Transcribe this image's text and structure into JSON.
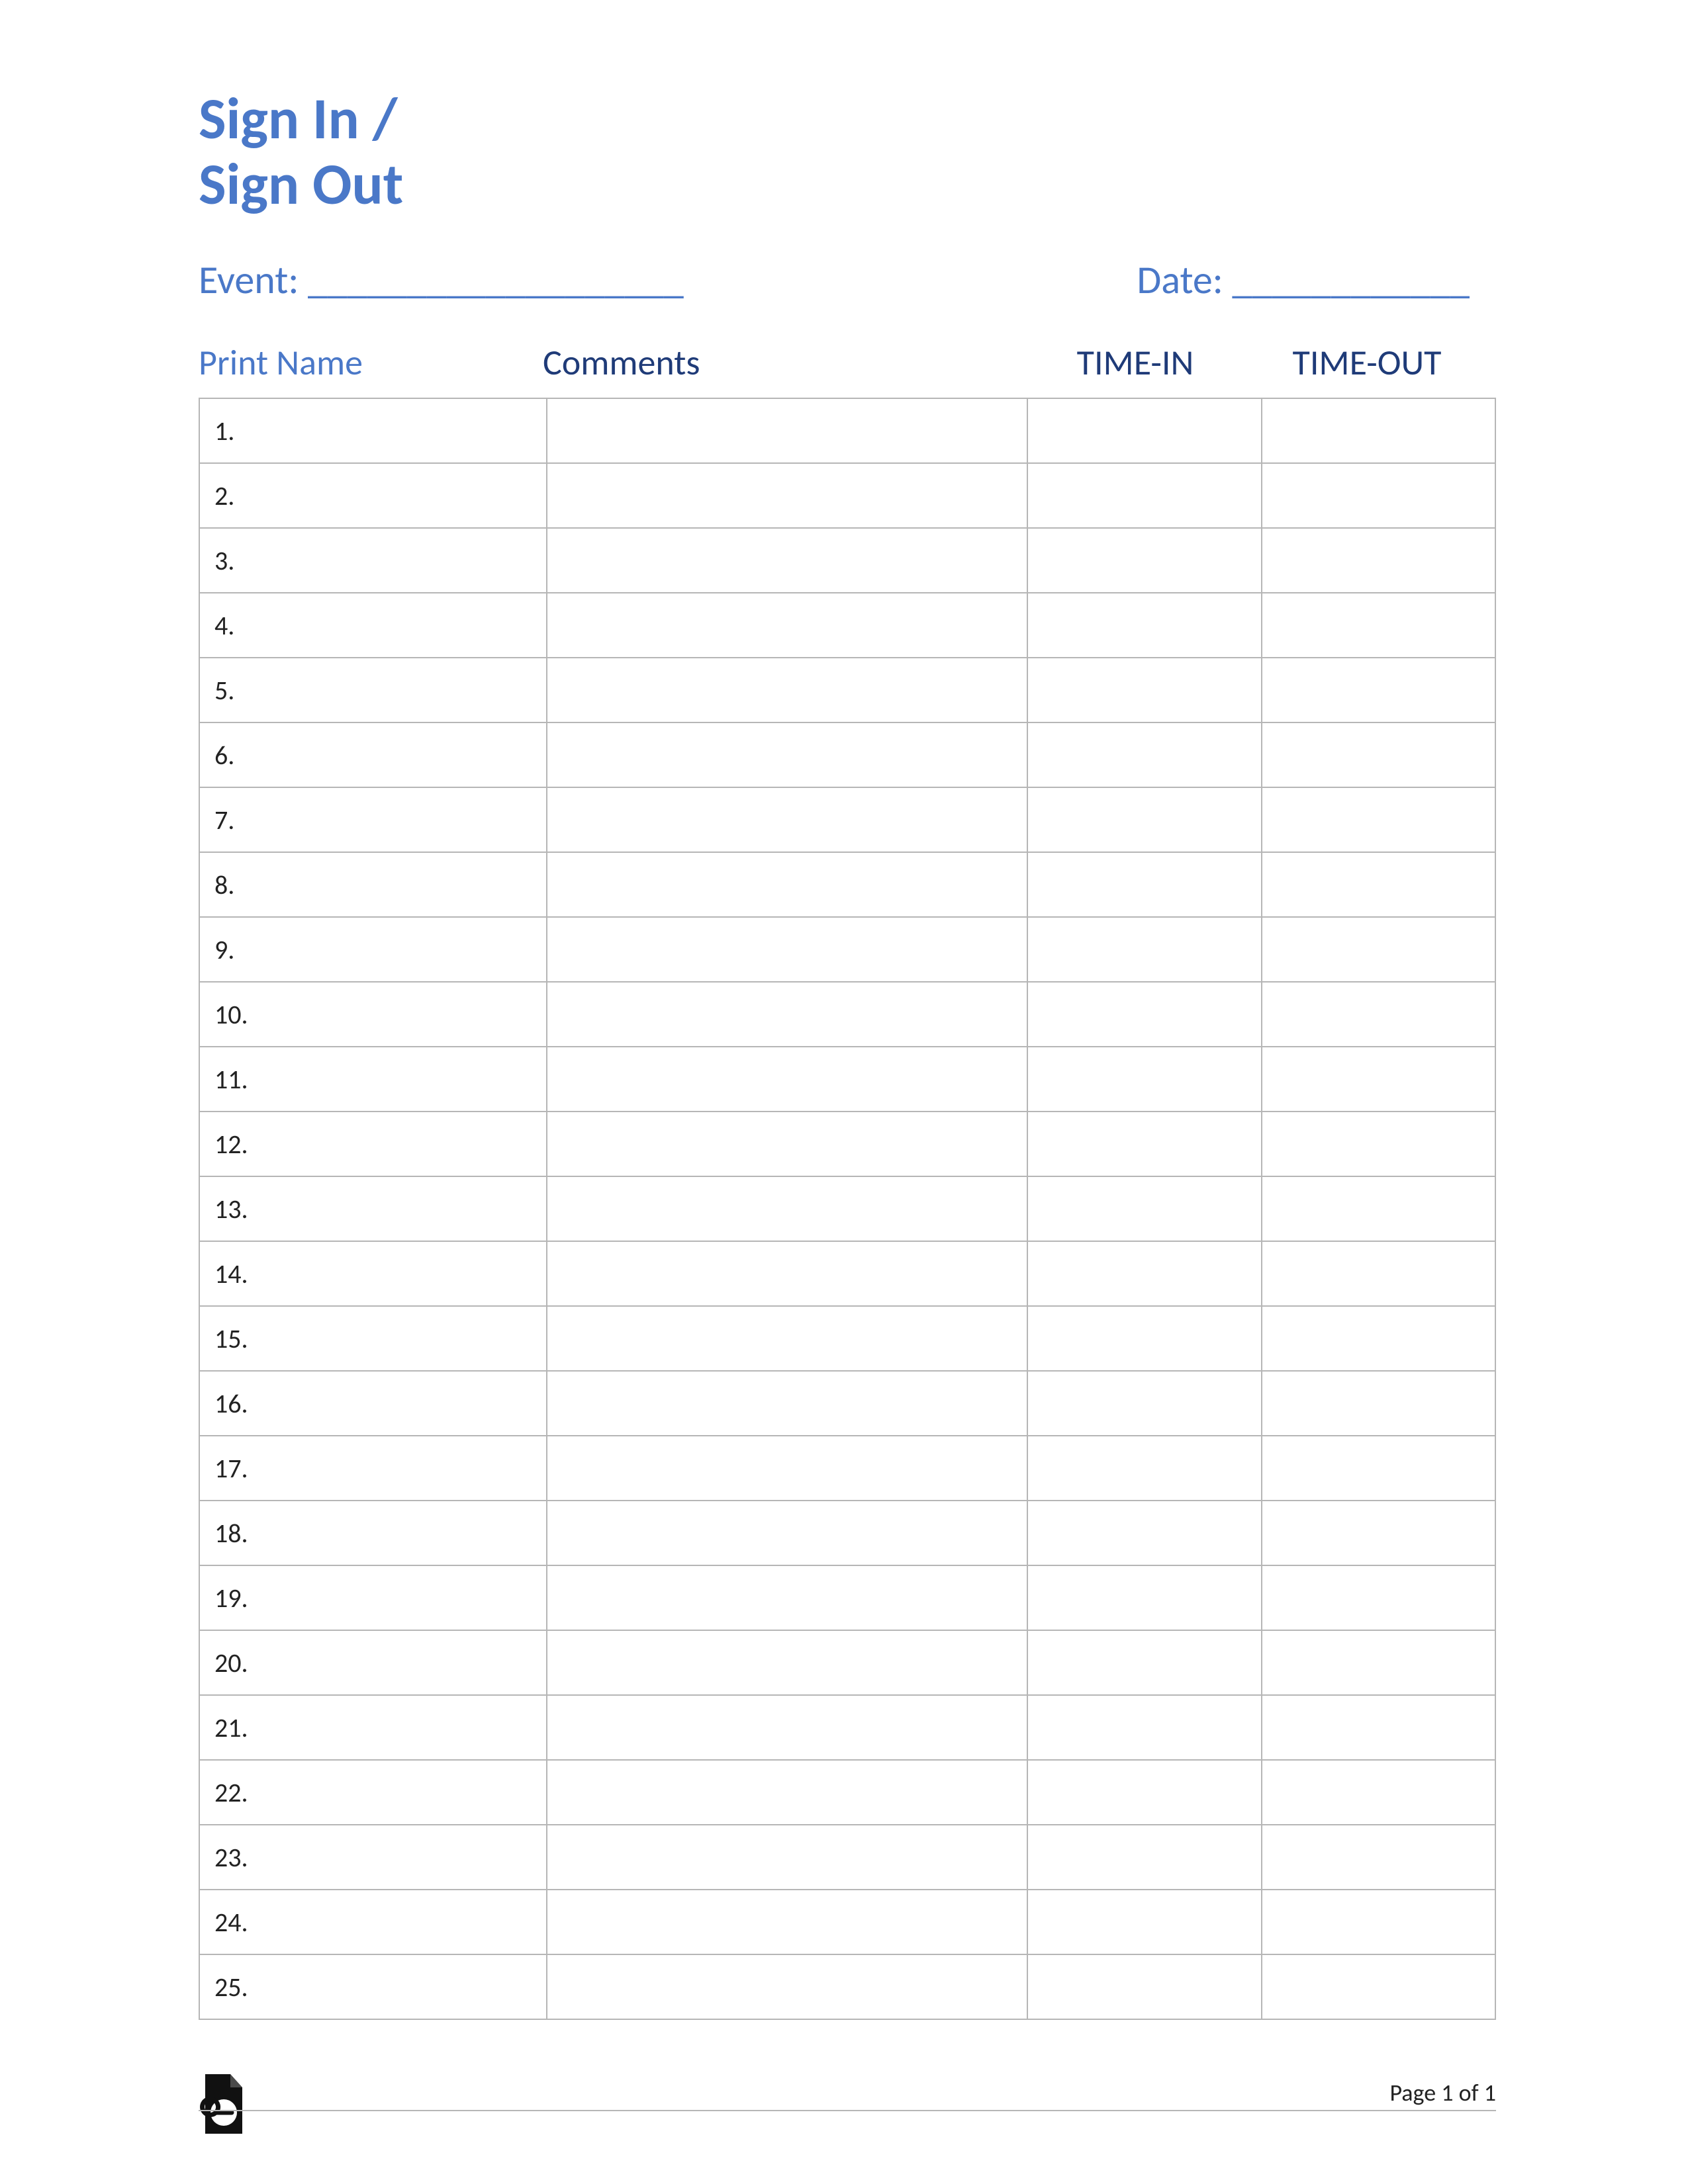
{
  "title": {
    "line1": "Sign In /",
    "line2": "Sign Out"
  },
  "meta": {
    "event_label": "Event: ___________________",
    "date_label": "Date: ____________"
  },
  "columns": {
    "print_name": "Print Name",
    "comments": "Comments",
    "time_in": "TIME-IN",
    "time_out": "TIME-OUT"
  },
  "rows": [
    {
      "num": "1."
    },
    {
      "num": "2."
    },
    {
      "num": "3."
    },
    {
      "num": "4."
    },
    {
      "num": "5."
    },
    {
      "num": "6."
    },
    {
      "num": "7."
    },
    {
      "num": "8."
    },
    {
      "num": "9."
    },
    {
      "num": "10."
    },
    {
      "num": "11."
    },
    {
      "num": "12."
    },
    {
      "num": "13."
    },
    {
      "num": "14."
    },
    {
      "num": "15."
    },
    {
      "num": "16."
    },
    {
      "num": "17."
    },
    {
      "num": "18."
    },
    {
      "num": "19."
    },
    {
      "num": "20."
    },
    {
      "num": "21."
    },
    {
      "num": "22."
    },
    {
      "num": "23."
    },
    {
      "num": "24."
    },
    {
      "num": "25."
    }
  ],
  "footer": {
    "page_label": "Page 1 of 1"
  }
}
